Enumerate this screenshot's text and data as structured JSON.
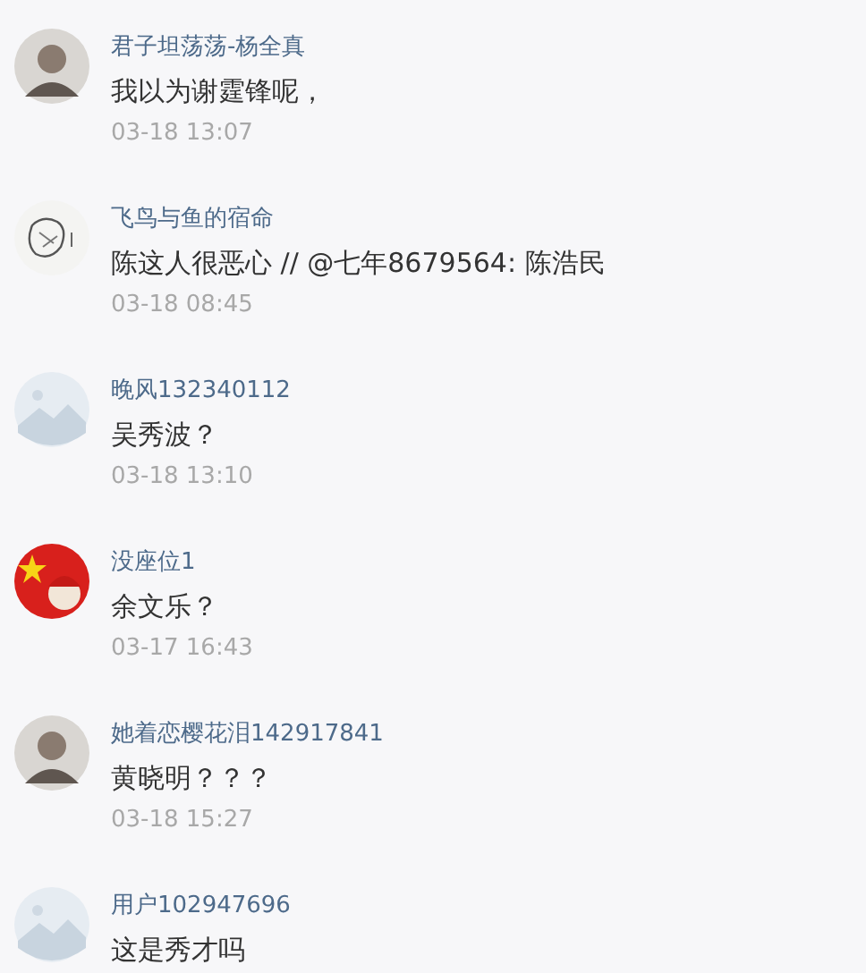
{
  "comments": [
    {
      "avatar": {
        "kind": "person"
      },
      "user": "君子坦荡荡-杨全真",
      "text": "我以为谢霆锋呢，",
      "time": "03-18 13:07"
    },
    {
      "avatar": {
        "kind": "sketch"
      },
      "user": "飞鸟与鱼的宿命",
      "text": "陈这人很恶心 // @七年8679564: 陈浩民",
      "time": "03-18 08:45"
    },
    {
      "avatar": {
        "kind": "default"
      },
      "user": "晚风132340112",
      "text": "吴秀波？",
      "time": "03-18 13:10"
    },
    {
      "avatar": {
        "kind": "flag"
      },
      "user": "没座位1",
      "text": "余文乐？",
      "time": "03-17 16:43"
    },
    {
      "avatar": {
        "kind": "person"
      },
      "user": "她着恋樱花泪142917841",
      "text": "黄晓明？？？",
      "time": "03-18 15:27"
    },
    {
      "avatar": {
        "kind": "default"
      },
      "user": "用户102947696",
      "text": "这是秀才吗"
    }
  ]
}
